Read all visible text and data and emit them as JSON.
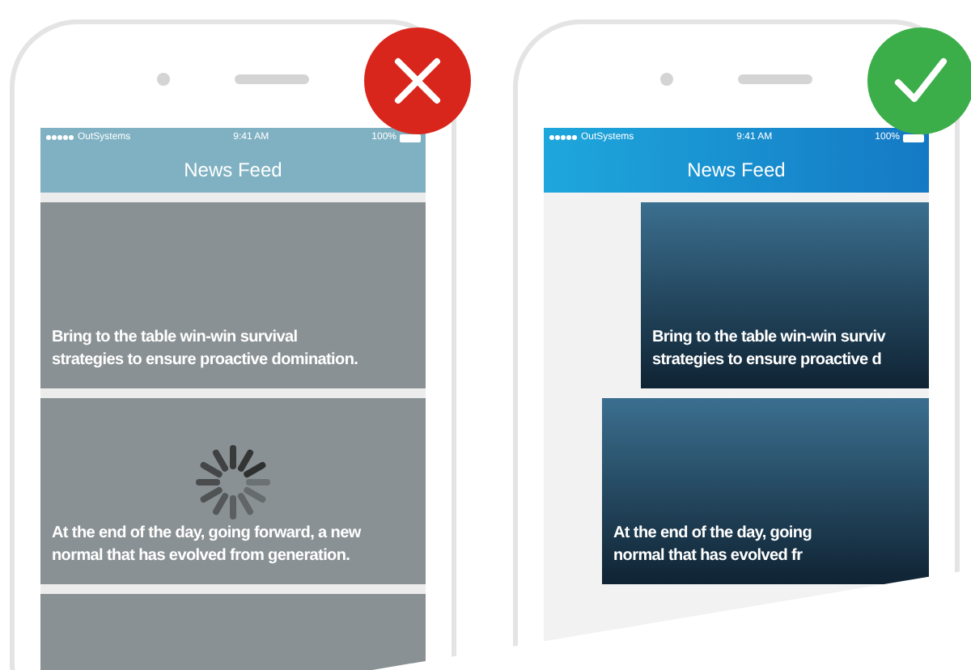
{
  "phones": [
    {
      "kind": "loading",
      "badge": {
        "kind": "cross"
      },
      "status_bar": {
        "carrier": "OutSystems",
        "time": "9:41 AM",
        "battery": "100%"
      },
      "title": "News Feed",
      "cards": [
        {
          "kind": "captioned",
          "caption_lines": [
            "Bring to the table win-win survival",
            "strategies to ensure proactive domination."
          ]
        },
        {
          "kind": "captioned",
          "caption_lines": [
            "At the end of the day, going forward, a new",
            "normal that has evolved from generation."
          ]
        },
        {
          "kind": "photo_only"
        }
      ]
    },
    {
      "kind": "swipe",
      "badge": {
        "kind": "check"
      },
      "status_bar": {
        "carrier": "OutSystems",
        "time": "9:41 AM",
        "battery": "100%"
      },
      "title": "News Feed",
      "cards": [
        {
          "kind": "captioned",
          "caption_lines": [
            "Bring to the table win-win surviv",
            "strategies to ensure proactive d"
          ]
        },
        {
          "kind": "captioned",
          "caption_lines": [
            "At the end of the day, going",
            "normal that has evolved fr"
          ]
        }
      ]
    }
  ]
}
